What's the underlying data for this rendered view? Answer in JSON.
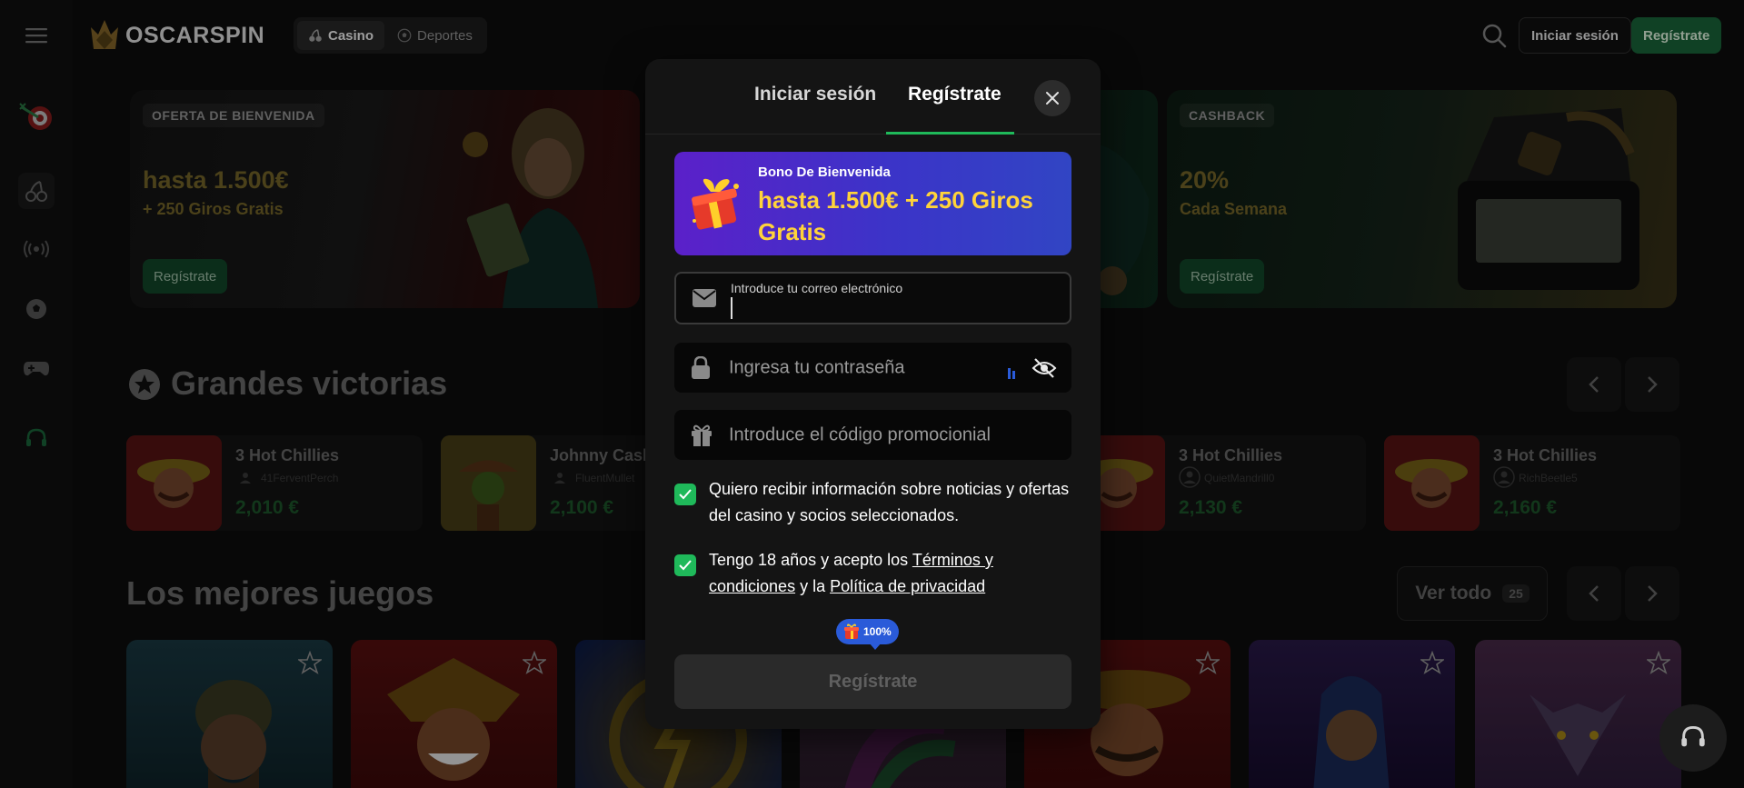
{
  "header": {
    "logo_text": "OSCARSPIN",
    "nav": [
      {
        "label": "Casino",
        "icon": "cherries-icon",
        "active": true
      },
      {
        "label": "Deportes",
        "icon": "soccer-ball-icon",
        "active": false
      }
    ],
    "login_label": "Iniciar sesión",
    "register_label": "Regístrate"
  },
  "sidebar": {
    "items": [
      {
        "icon": "menu-icon"
      },
      {
        "icon": "dart-target-icon"
      },
      {
        "icon": "cherries-icon",
        "active": true
      },
      {
        "icon": "live-broadcast-icon"
      },
      {
        "icon": "soccer-ball-icon"
      },
      {
        "icon": "gamepad-icon"
      },
      {
        "icon": "headset-icon"
      }
    ]
  },
  "banners": [
    {
      "tag": "OFERTA DE BIENVENIDA",
      "title": "hasta 1.500€",
      "subtitle": "+ 250 Giros Gratis",
      "button": "Regístrate"
    },
    {
      "tag": "CASHBACK",
      "title": "20%",
      "subtitle": "Cada Semana",
      "button": "Regístrate"
    }
  ],
  "big_wins": {
    "title": "Grandes victorias",
    "items": [
      {
        "game": "3 Hot Chillies",
        "user": "41FerventPerch",
        "amount": "2,010 €"
      },
      {
        "game": "Johnny Cash",
        "user": "FluentMullet",
        "amount": "2,100 €"
      },
      {
        "game": "3 Hot Chillies",
        "user": "QuietMandrill0",
        "amount": "2,130 €"
      },
      {
        "game": "3 Hot Chillies",
        "user": "RichBeetle5",
        "amount": "2,160 €"
      }
    ]
  },
  "top_games": {
    "title": "Los mejores juegos",
    "view_all_label": "Ver todo",
    "view_all_count": "25"
  },
  "modal": {
    "tabs": [
      {
        "label": "Iniciar sesión",
        "active": false
      },
      {
        "label": "Regístrate",
        "active": true
      }
    ],
    "bonus": {
      "label": "Bono De Bienvenida",
      "text": "hasta 1.500€ + 250 Giros Gratis"
    },
    "email": {
      "label": "Introduce tu correo electrónico",
      "value": ""
    },
    "password": {
      "placeholder": "Ingresa tu contraseña"
    },
    "promo": {
      "placeholder": "Introduce el código promocionial"
    },
    "consent_marketing": {
      "checked": true,
      "text": "Quiero recibir información sobre noticias y ofertas del casino y socios seleccionados."
    },
    "consent_terms": {
      "checked": true,
      "text_before": "Tengo 18 años y acepto los ",
      "terms_link": "Términos y condiciones",
      "text_mid": " y la ",
      "privacy_link": "Política de privacidad"
    },
    "progress_badge": "100%",
    "submit_label": "Regístrate"
  },
  "colors": {
    "accent_green": "#1fb95a",
    "bonus_gradient_start": "#5b20c9",
    "bonus_gradient_end": "#3145c4",
    "bonus_text": "#ffd33a"
  }
}
